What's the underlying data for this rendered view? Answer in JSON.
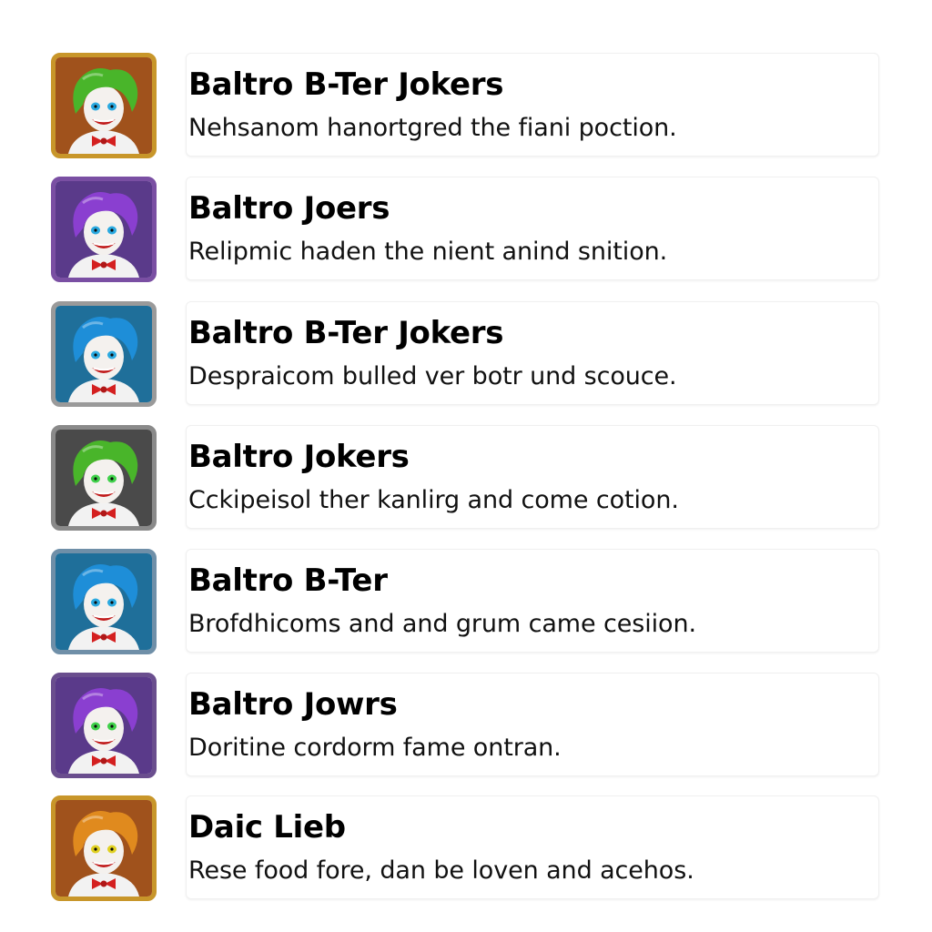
{
  "jokers": [
    {
      "name": "Baltro B-Ter Jokers",
      "description": "Nehsanom  hanortgred the fiani  poction.",
      "frame_color": "#c8962a",
      "bg_color": "#a0521c",
      "hair_color": "#49b52a",
      "eye_color": "#2aa9e0",
      "icon": "joker-portrait-icon"
    },
    {
      "name": "Baltro Joers",
      "description": "Relipmic haden the nient anind snition.",
      "frame_color": "#7a4fa3",
      "bg_color": "#5a3a8a",
      "hair_color": "#8a3fd0",
      "eye_color": "#2aa9e0",
      "icon": "joker-portrait-icon"
    },
    {
      "name": "Baltro B-Ter Jokers",
      "description": "Despraicom bulled ver botr und scouce.",
      "frame_color": "#9a9a9a",
      "bg_color": "#1f6f9a",
      "hair_color": "#1e8ed8",
      "eye_color": "#2aa9e0",
      "icon": "joker-portrait-icon"
    },
    {
      "name": "Baltro Jokers",
      "description": "Cckipeisol ther kanlirg and come cotion.",
      "frame_color": "#8a8a8a",
      "bg_color": "#4a4a4a",
      "hair_color": "#49b52a",
      "eye_color": "#3fd04a",
      "icon": "joker-portrait-icon"
    },
    {
      "name": "Baltro B-Ter",
      "description": "Brofdhicoms and and grum came cesiion.",
      "frame_color": "#6f8fa8",
      "bg_color": "#1f6f9a",
      "hair_color": "#1e8ed8",
      "eye_color": "#2aa9e0",
      "icon": "joker-portrait-icon"
    },
    {
      "name": "Baltro Jowrs",
      "description": "Doritine cordorm fame ontran.",
      "frame_color": "#6a4e8e",
      "bg_color": "#5a3a8a",
      "hair_color": "#8a3fd0",
      "eye_color": "#3fd04a",
      "icon": "joker-portrait-icon"
    },
    {
      "name": "Daic Lieb",
      "description": "Rese food fore, dan be loven and acehos.",
      "frame_color": "#c8962a",
      "bg_color": "#a0521c",
      "hair_color": "#e08a1e",
      "eye_color": "#e0d020",
      "icon": "joker-portrait-icon"
    }
  ]
}
